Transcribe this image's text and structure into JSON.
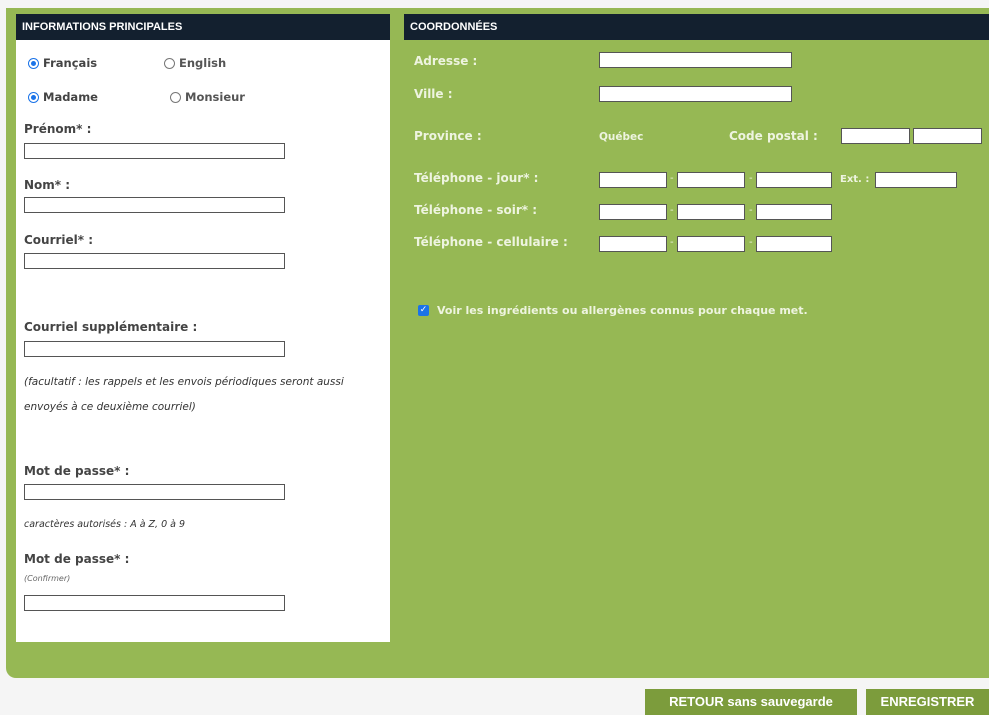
{
  "left_section": {
    "title": "INFORMATIONS PRINCIPALES",
    "language": {
      "options": [
        "Français",
        "English"
      ],
      "selected": "Français"
    },
    "civility": {
      "options": [
        "Madame",
        "Monsieur"
      ],
      "selected": "Madame"
    },
    "prenom_label": "Prénom* :",
    "prenom_value": "",
    "nom_label": "Nom* :",
    "nom_value": "",
    "courriel_label": "Courriel* :",
    "courriel_value": "",
    "courriel_supp_label": "Courriel supplémentaire :",
    "courriel_supp_value": "",
    "courriel_supp_note_1": "(facultatif : les rappels et les envois périodiques seront aussi",
    "courriel_supp_note_2": "envoyés à ce deuxième courriel)",
    "mdp_label": "Mot de passe* :",
    "mdp_value": "",
    "mdp_hint": "caractères autorisés : A à Z, 0 à 9",
    "mdp2_label": "Mot de passe* :",
    "mdp2_sub": "(Confirmer)",
    "mdp2_value": ""
  },
  "right_section": {
    "title": "COORDONNÉES",
    "adresse_label": "Adresse :",
    "ville_label": "Ville :",
    "province_label": "Province :",
    "province_value": "Québec",
    "code_postal_label": "Code postal :",
    "tel_jour_label": "Téléphone - jour* :",
    "ext_label": "Ext. :",
    "tel_soir_label": "Téléphone - soir* :",
    "tel_cell_label": "Téléphone - cellulaire :",
    "dash": "-",
    "checkbox_label": "Voir les ingrédients ou allergènes connus pour chaque met.",
    "checkbox_checked": true
  },
  "footer": {
    "retour_label": "RETOUR sans sauvegarde",
    "enregistrer_label": "ENREGISTRER"
  },
  "colors": {
    "header_bg": "#13202f",
    "panel_green": "#96b854",
    "button_green": "#7c9c3c",
    "radio_blue": "#1a73e8"
  }
}
